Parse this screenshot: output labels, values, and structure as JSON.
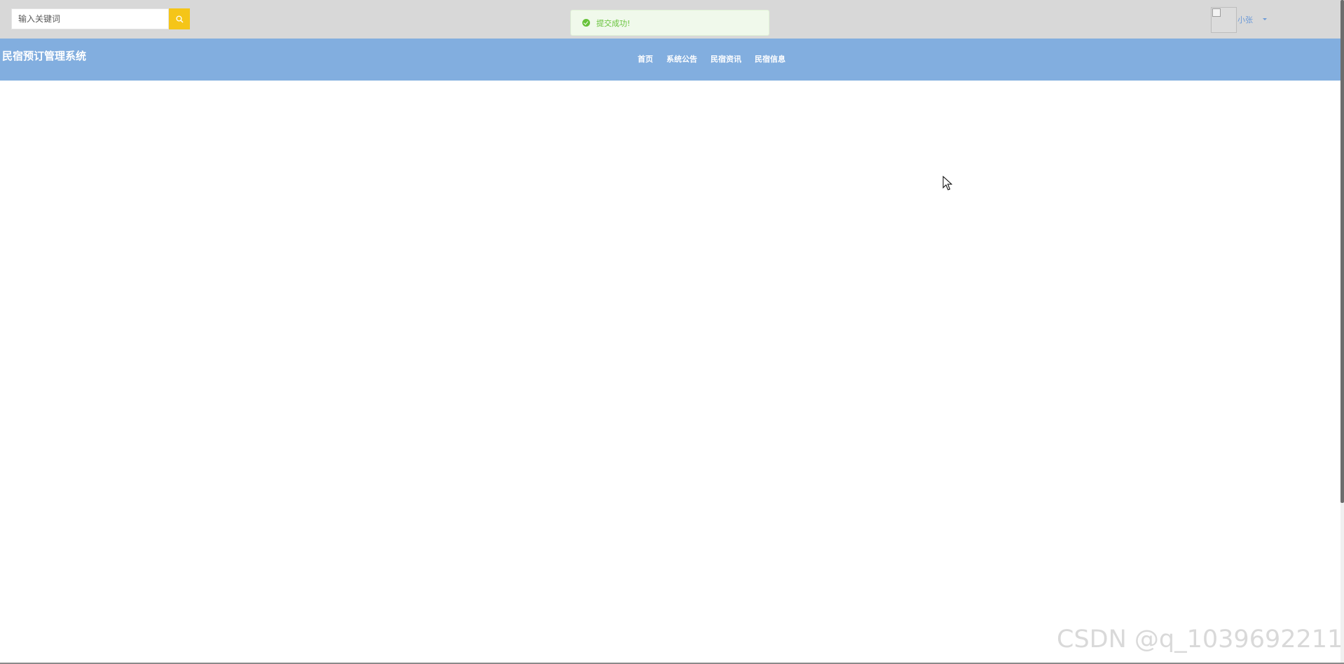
{
  "search": {
    "placeholder": "输入关键词",
    "button_color": "#f5c518"
  },
  "toast": {
    "message": "提交成功!",
    "icon": "success-check-icon",
    "color": "#67c23a"
  },
  "user": {
    "name": "小张",
    "avatar_icon": "broken-image-icon"
  },
  "header": {
    "title": "民宿预订管理系统",
    "background_color": "#82aedf",
    "nav": [
      {
        "label": "首页"
      },
      {
        "label": "系统公告"
      },
      {
        "label": "民宿资讯"
      },
      {
        "label": "民宿信息"
      }
    ]
  },
  "watermark": "CSDN @q_1039692211"
}
